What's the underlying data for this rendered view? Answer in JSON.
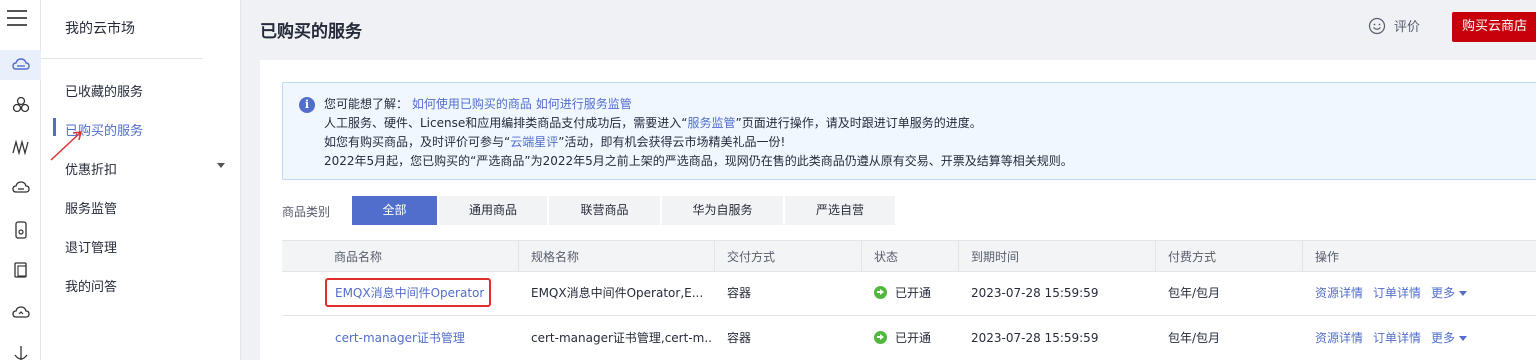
{
  "rail": {
    "icons": [
      "menu-icon",
      "cloud-icon",
      "nodes-icon",
      "wave-icon",
      "cloud-service-icon",
      "phone-icon",
      "document-icon",
      "cloud-upload-icon",
      "anchor-icon"
    ]
  },
  "nav": {
    "title": "我的云市场",
    "items": [
      {
        "label": "已收藏的服务"
      },
      {
        "label": "已购买的服务"
      },
      {
        "label": "优惠折扣"
      },
      {
        "label": "服务监管"
      },
      {
        "label": "退订管理"
      },
      {
        "label": "我的问答"
      }
    ]
  },
  "header": {
    "title": "已购买的服务",
    "rate_label": "评价",
    "buy_button": "购买云商店"
  },
  "info": {
    "line1_prefix": "您可能想了解：",
    "line1_link1": "如何使用已购买的商品",
    "line1_link2": "如何进行服务监管",
    "line2_prefix": "人工服务、硬件、License和应用编排类商品支付成功后，需要进入“",
    "line2_link": "服务监管",
    "line2_suffix": "”页面进行操作，请及时跟进订单服务的进度。",
    "line3_prefix": "如您有购买商品，及时评价可参与“",
    "line3_link": "云端星评",
    "line3_suffix": "”活动，即有机会获得云市场精美礼品一份!",
    "line4": "2022年5月起，您已购买的“严选商品”为2022年5月之前上架的严选商品，现网仍在售的此类商品仍遵从原有交易、开票及结算等相关规则。"
  },
  "filter": {
    "label": "商品类别",
    "options": [
      "全部",
      "通用商品",
      "联营商品",
      "华为自服务",
      "严选自营"
    ],
    "selected": "全部"
  },
  "table": {
    "columns": [
      "商品名称",
      "规格名称",
      "交付方式",
      "状态",
      "到期时间",
      "付费方式",
      "操作"
    ],
    "rows": [
      {
        "name": "EMQX消息中间件Operator",
        "spec": "EMQX消息中间件Operator,E...",
        "delivery": "容器",
        "status": "已开通",
        "expiry": "2023-07-28 15:59:59",
        "billing": "包年/包月",
        "ops": [
          "资源详情",
          "订单详情",
          "更多"
        ]
      },
      {
        "name": "cert-manager证书管理",
        "spec": "cert-manager证书管理,cert-m...",
        "delivery": "容器",
        "status": "已开通",
        "expiry": "2023-07-28 15:59:59",
        "billing": "包年/包月",
        "ops": [
          "资源详情",
          "订单详情",
          "更多"
        ]
      }
    ]
  },
  "colors": {
    "accent": "#526ecc",
    "brand_red": "#c7000b",
    "status_green": "#50b83c",
    "annotation_red": "#e0302d"
  }
}
